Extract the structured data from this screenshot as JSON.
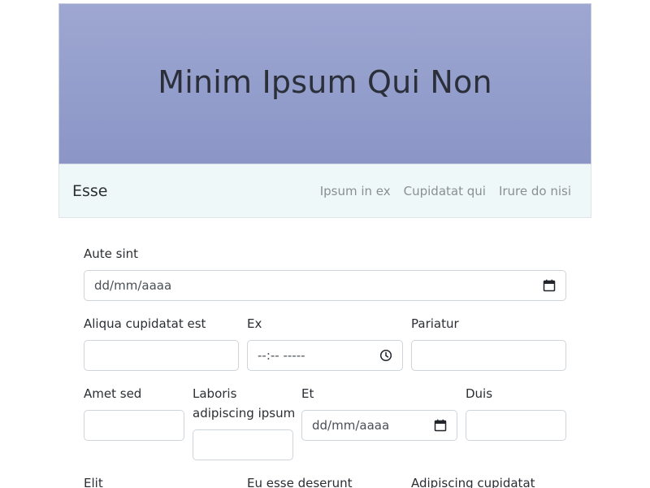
{
  "hero": {
    "title": "Minim Ipsum Qui Non"
  },
  "navbar": {
    "brand": "Esse",
    "links": [
      "Ipsum in ex",
      "Cupidatat qui",
      "Irure do nisi"
    ]
  },
  "form": {
    "row1": {
      "label": "Aute sint",
      "value": "dd/mm/aaaa",
      "icon": "calendar-icon"
    },
    "row2": {
      "fields": [
        {
          "label": "Aliqua cupidatat est",
          "value": ""
        },
        {
          "label": "Ex",
          "value": "--:-- -----",
          "icon": "clock-icon"
        },
        {
          "label": "Pariatur",
          "value": ""
        }
      ]
    },
    "row3": {
      "fields": [
        {
          "label": "Amet sed",
          "value": ""
        },
        {
          "label_line1": "Laboris",
          "label_line2": "adipiscing ipsum",
          "value": ""
        },
        {
          "label": "Et",
          "value": "dd/mm/aaaa",
          "icon": "calendar-icon"
        },
        {
          "label": "Duis",
          "value": ""
        }
      ]
    },
    "row4": {
      "labels": [
        "Elit",
        "Eu esse deserunt",
        "Adipiscing cupidatat"
      ]
    }
  }
}
